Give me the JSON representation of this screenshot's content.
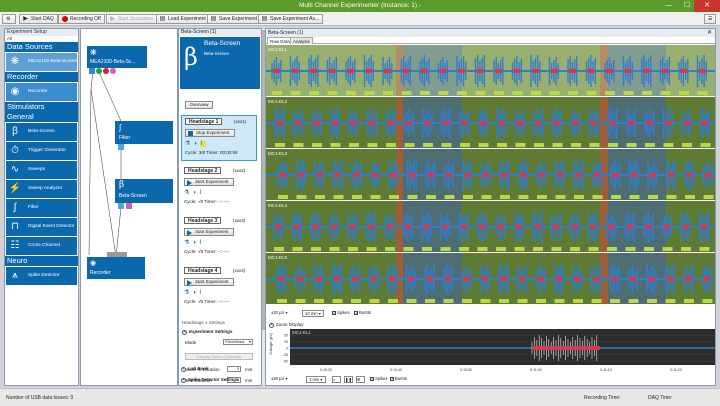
{
  "window": {
    "title": "Multi Channel Experimenter (Instance: 1) -",
    "min": "—",
    "max": "☐",
    "close": "✕",
    "titlebar_color": "#5a9b2c"
  },
  "toolbar": {
    "settings_icon": "⚙",
    "start_daq": "Start DAQ",
    "recording": "Recording Off",
    "start_simulation": "Start Simulation",
    "load_experiment": "Load Experiment",
    "save_experiment": "Save Experiment",
    "save_experiment_as": "Save Experiment As...",
    "help_icon": "☰"
  },
  "left_panel": {
    "title": "Experiment Setup",
    "tab": "All",
    "categories": [
      {
        "label": "Data Sources",
        "items": [
          {
            "label": "MEA2100-Beta-Screen",
            "icon": "mea-icon"
          }
        ]
      },
      {
        "label": "Recorder",
        "items": [
          {
            "label": "Recorder",
            "icon": "record-icon"
          }
        ]
      },
      {
        "label": "Stimulators",
        "items": []
      },
      {
        "label": "General",
        "items": [
          {
            "label": "Beta-Screen",
            "icon": "β"
          },
          {
            "label": "Trigger Generator",
            "icon": "⏱"
          },
          {
            "label": "Sweeps",
            "icon": "∿"
          },
          {
            "label": "Sweep Analyzer",
            "icon": "⚡"
          },
          {
            "label": "Filter",
            "icon": "∫"
          },
          {
            "label": "Digital Event Detector",
            "icon": "⊓"
          },
          {
            "label": "Cross-Channel",
            "icon": "☷"
          }
        ]
      },
      {
        "label": "Neuro",
        "items": [
          {
            "label": "Spike Detector",
            "icon": "⩚"
          }
        ]
      }
    ]
  },
  "graph": {
    "source": "MEA2100-Beta-Sc...",
    "filter": "Filter",
    "beta": "Beta-Screen",
    "recorder": "Recorder"
  },
  "beta_panel": {
    "panel_title": "Beta-Screen (1)",
    "symbol": "β",
    "title": "Beta-Screen",
    "subtitle": "Beta-Screen",
    "overview": "Overview",
    "headstages": [
      {
        "name": "Headstage 1",
        "index": "(xxx1)",
        "button": "Stop Experiment",
        "status": "Cycle: 3/8   Timer: 00:00:59",
        "active": true
      },
      {
        "name": "Headstage 2",
        "index": "(xxx2)",
        "button": "Start Experiment",
        "status": "Cycle: -/8   Timer: --:--:--",
        "active": false
      },
      {
        "name": "Headstage 3",
        "index": "(xxx3)",
        "button": "Start Experiment",
        "status": "Cycle: -/8   Timer: --:--:--",
        "active": false
      },
      {
        "name": "Headstage 4",
        "index": "(xxx4)",
        "button": "Start Experiment",
        "status": "Cycle: -/8   Timer: --:--:--",
        "active": false
      }
    ],
    "settings_label": "Headstage 1 Settings",
    "experiment_settings": "Experiment Settings",
    "mode_label": "Mode",
    "mode_value": "Predefined",
    "display_series": "Display Series (Optional)",
    "washin_label": "Wash In Duration",
    "washin_value": "3",
    "test_label": "Test Duration",
    "test_value": "3",
    "unit": "min",
    "lab_book": "Lab Book",
    "spike_settings": "Spike Detector Settings"
  },
  "plot_panel": {
    "title": "Beta-Screen (1)",
    "close": "✕",
    "tabs": [
      "Raw Data",
      "Analysis"
    ],
    "channels": [
      "MC1-EL1",
      "MC1-EL2",
      "MC1-EL3",
      "MC1-EL4",
      "MC1-EL5"
    ],
    "scale": "±30 µV",
    "time": "10 min",
    "spikes": "Spikes",
    "bursts": "Bursts",
    "zoom_display": "Zoom Display",
    "zoom_channel": "MC1-EL1",
    "zoom_ylabel": "Voltage (µV)",
    "zoom_yticks": [
      "50",
      "25",
      "0",
      "-25",
      "-50"
    ],
    "zoom_xticks": [
      "0:10:30",
      "0:10:40",
      "0:10:50",
      "0:11:00",
      "0:11:10",
      "0:11:20"
    ],
    "zoom_scale": "±30 µV",
    "zoom_time": "1 min",
    "colors": {
      "trace": "#2f7fd0",
      "bg": "#5f7a32",
      "band_red": "#b8523a",
      "band_blue": "#3f63a8",
      "burst": "#e0344c"
    }
  },
  "status": {
    "usb_losses": "Number of USB data losses:  0",
    "recording_time": "Recording Time:",
    "daq_time": "DAQ Time:"
  }
}
